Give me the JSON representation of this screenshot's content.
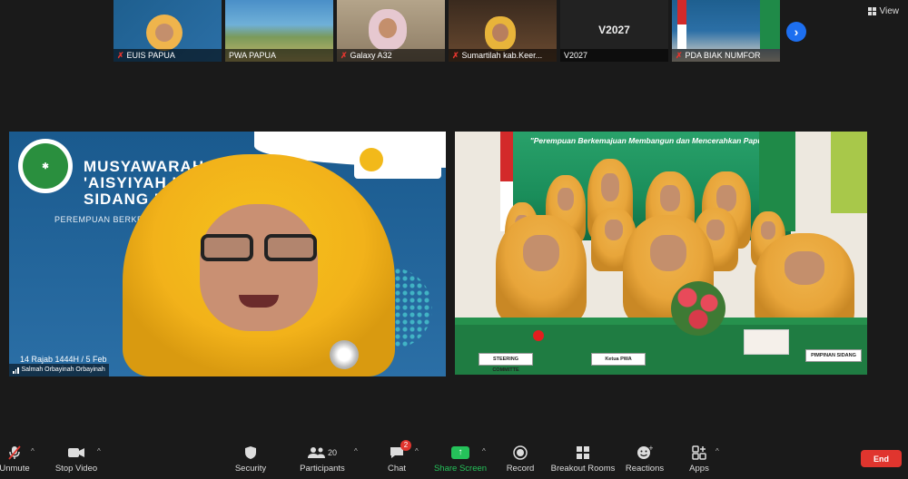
{
  "top_strip": {
    "participants": [
      {
        "name": "EUIS PAPUA",
        "muted": true
      },
      {
        "name": "PWA PAPUA",
        "muted": false
      },
      {
        "name": "Galaxy A32",
        "muted": true
      },
      {
        "name": "Sumartilah kab.Keer...",
        "muted": true
      },
      {
        "name": "V2027",
        "muted": false,
        "center_label": "V2027"
      },
      {
        "name": "PDA BIAK NUMFOR",
        "muted": true
      }
    ],
    "view_label": "View"
  },
  "left_tile": {
    "banner_title": "MUSYAWARAH WILAYAH\n'AISYIYAH KE-\nSIDANG P",
    "banner_subtitle": "PEREMPUAN BERKEMAJUAN ME                        PAPUA",
    "date_text": "14 Rajab 1444H / 5 Feb",
    "speaker_name": "Salmah Orbayinah Orbayinah"
  },
  "right_tile": {
    "banner_caption": "\"Perempuan Berkemajuan Membangun dan Mencerahkan Papua\"",
    "plaques": [
      "STEERING COMMITTE",
      "Ketua PWA",
      "PIMPINAN SIDANG"
    ]
  },
  "toolbar": {
    "unmute": "Unmute",
    "stop_video": "Stop Video",
    "security": "Security",
    "participants": "Participants",
    "participants_count": "20",
    "chat": "Chat",
    "chat_badge": "2",
    "share_screen": "Share Screen",
    "record": "Record",
    "breakout_rooms": "Breakout Rooms",
    "reactions": "Reactions",
    "apps": "Apps",
    "end": "End"
  },
  "colors": {
    "accent_blue": "#1d6ff0",
    "end_red": "#e0352e",
    "share_green": "#25c25a"
  }
}
